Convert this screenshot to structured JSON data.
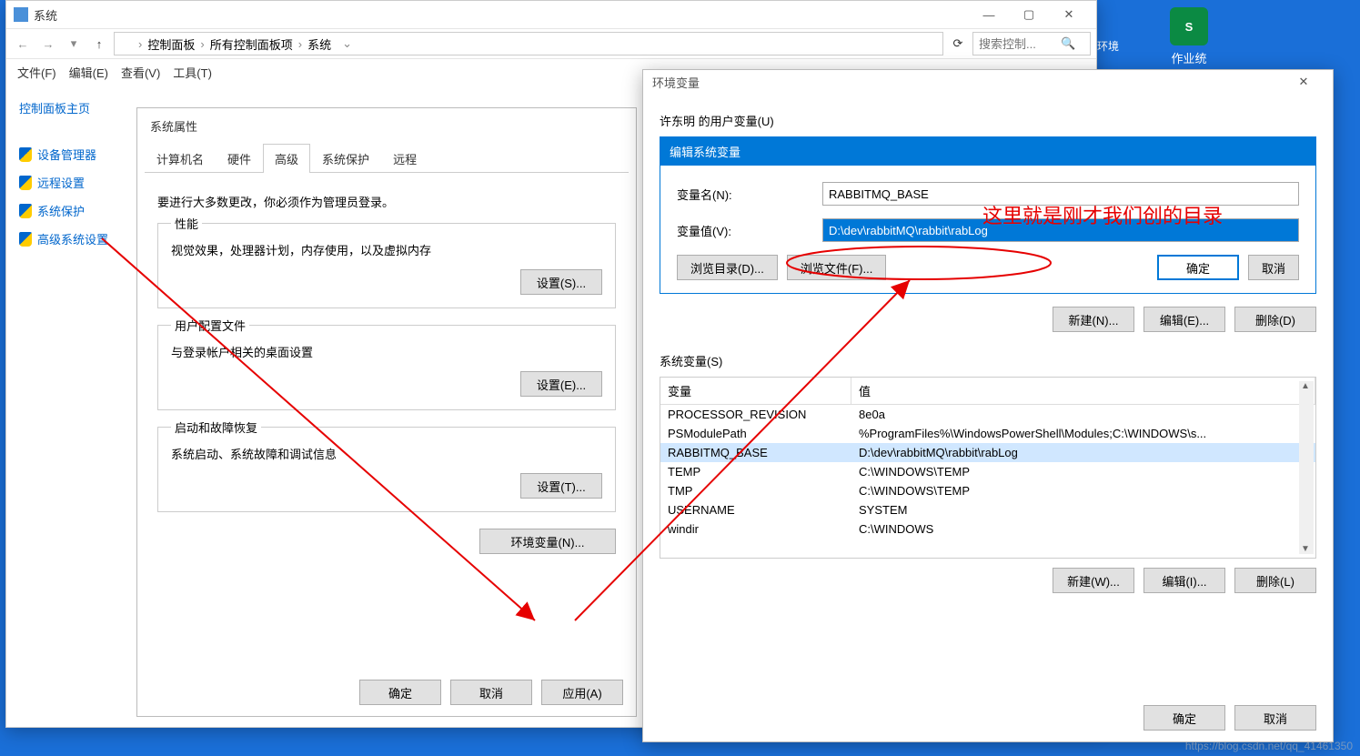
{
  "desktop": {
    "file_label": "作业统计.xlsx",
    "other_label": "环境"
  },
  "system_window": {
    "title": "系统",
    "breadcrumb": [
      "控制面板",
      "所有控制面板项",
      "系统"
    ],
    "search_placeholder": "搜索控制...",
    "menus": [
      "文件(F)",
      "编辑(E)",
      "查看(V)",
      "工具(T)"
    ],
    "sidebar_title": "控制面板主页",
    "sidebar_items": [
      "设备管理器",
      "远程设置",
      "系统保护",
      "高级系统设置"
    ]
  },
  "sysprop": {
    "title": "系统属性",
    "tabs": [
      "计算机名",
      "硬件",
      "高级",
      "系统保护",
      "远程"
    ],
    "note": "要进行大多数更改，你必须作为管理员登录。",
    "perf_legend": "性能",
    "perf_desc": "视觉效果，处理器计划，内存使用，以及虚拟内存",
    "perf_btn": "设置(S)...",
    "profile_legend": "用户配置文件",
    "profile_desc": "与登录帐户相关的桌面设置",
    "profile_btn": "设置(E)...",
    "startup_legend": "启动和故障恢复",
    "startup_desc": "系统启动、系统故障和调试信息",
    "startup_btn": "设置(T)...",
    "envvar_btn": "环境变量(N)...",
    "ok": "确定",
    "cancel": "取消",
    "apply": "应用(A)"
  },
  "env": {
    "title": "环境变量",
    "user_section": "许东明 的用户变量(U)",
    "edit_header": "编辑系统变量",
    "name_label": "变量名(N):",
    "name_value": "RABBITMQ_BASE",
    "value_label": "变量值(V):",
    "value_value": "D:\\dev\\rabbitMQ\\rabbit\\rabLog",
    "browse_dir": "浏览目录(D)...",
    "browse_file": "浏览文件(F)...",
    "ok": "确定",
    "cancel": "取消",
    "new_n": "新建(N)...",
    "edit_e": "编辑(E)...",
    "del_d": "删除(D)",
    "sys_section": "系统变量(S)",
    "col_var": "变量",
    "col_val": "值",
    "sys_vars": [
      {
        "name": "PROCESSOR_REVISION",
        "value": "8e0a"
      },
      {
        "name": "PSModulePath",
        "value": "%ProgramFiles%\\WindowsPowerShell\\Modules;C:\\WINDOWS\\s..."
      },
      {
        "name": "RABBITMQ_BASE",
        "value": "D:\\dev\\rabbitMQ\\rabbit\\rabLog"
      },
      {
        "name": "TEMP",
        "value": "C:\\WINDOWS\\TEMP"
      },
      {
        "name": "TMP",
        "value": "C:\\WINDOWS\\TEMP"
      },
      {
        "name": "USERNAME",
        "value": "SYSTEM"
      },
      {
        "name": "windir",
        "value": "C:\\WINDOWS"
      }
    ],
    "new_w": "新建(W)...",
    "edit_i": "编辑(I)...",
    "del_l": "删除(L)"
  },
  "annotation": "这里就是刚才我们创的目录",
  "watermark": "https://blog.csdn.net/qq_41461350"
}
